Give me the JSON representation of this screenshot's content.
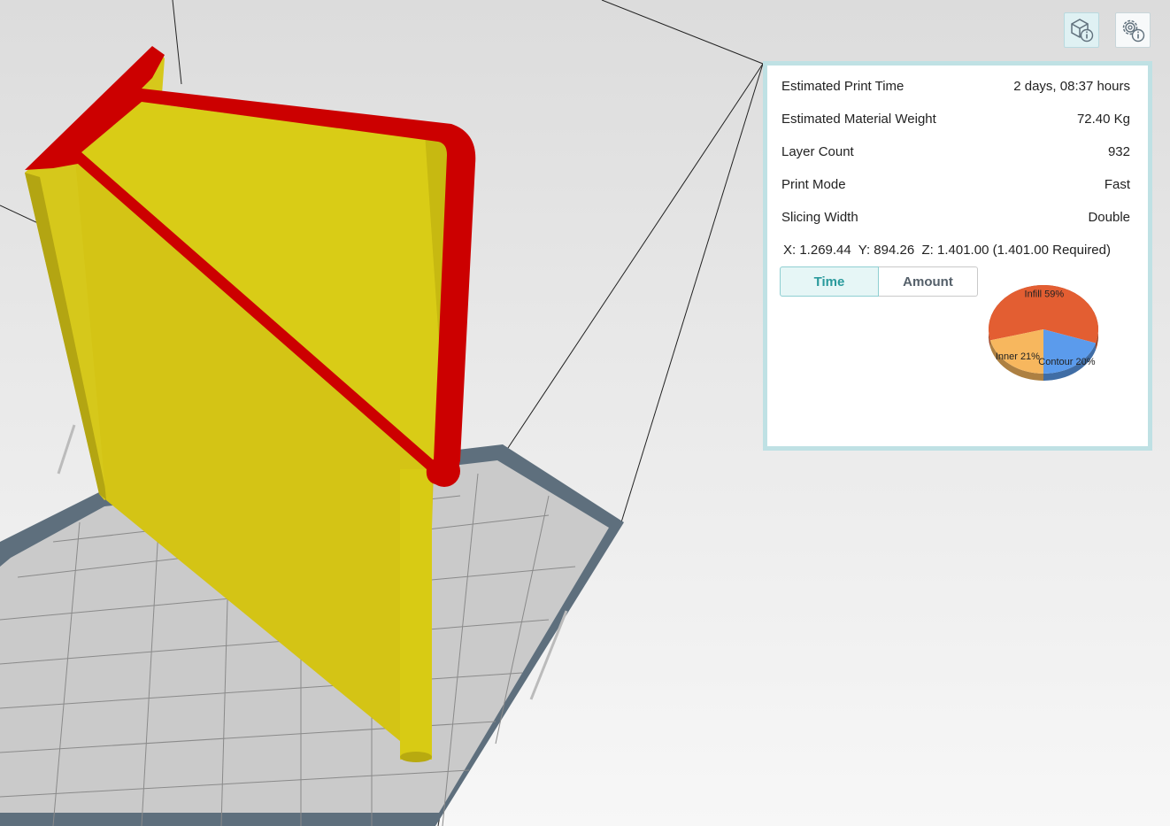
{
  "toolbar": {
    "model_info_icon": "cube-info-icon",
    "settings_info_icon": "gear-info-icon"
  },
  "info": {
    "rows": [
      {
        "label": "Estimated Print Time",
        "value": "2 days, 08:37 hours"
      },
      {
        "label": "Estimated Material Weight",
        "value": "72.40 Kg"
      },
      {
        "label": "Layer Count",
        "value": "932"
      },
      {
        "label": "Print Mode",
        "value": "Fast"
      },
      {
        "label": "Slicing Width",
        "value": "Double"
      }
    ],
    "coords": "X: 1.269.44  Y: 894.26  Z: 1.401.00 (1.401.00 Required)"
  },
  "tabs": {
    "time": "Time",
    "amount": "Amount",
    "active": "Time"
  },
  "chart_data": {
    "type": "pie",
    "slices": [
      {
        "label": "Infill 59%",
        "value": 59,
        "color": "#e35e32"
      },
      {
        "label": "Contour 20%",
        "value": 20,
        "color": "#5b9bec"
      },
      {
        "label": "Inner 21%",
        "value": 21,
        "color": "#f7b75e"
      }
    ]
  },
  "colors": {
    "panel_border": "#bfe1e4",
    "model_fill": "#d9c914",
    "model_top": "#cc0000",
    "bed": "#c8c8c8",
    "bed_frame": "#5c6e7c"
  }
}
